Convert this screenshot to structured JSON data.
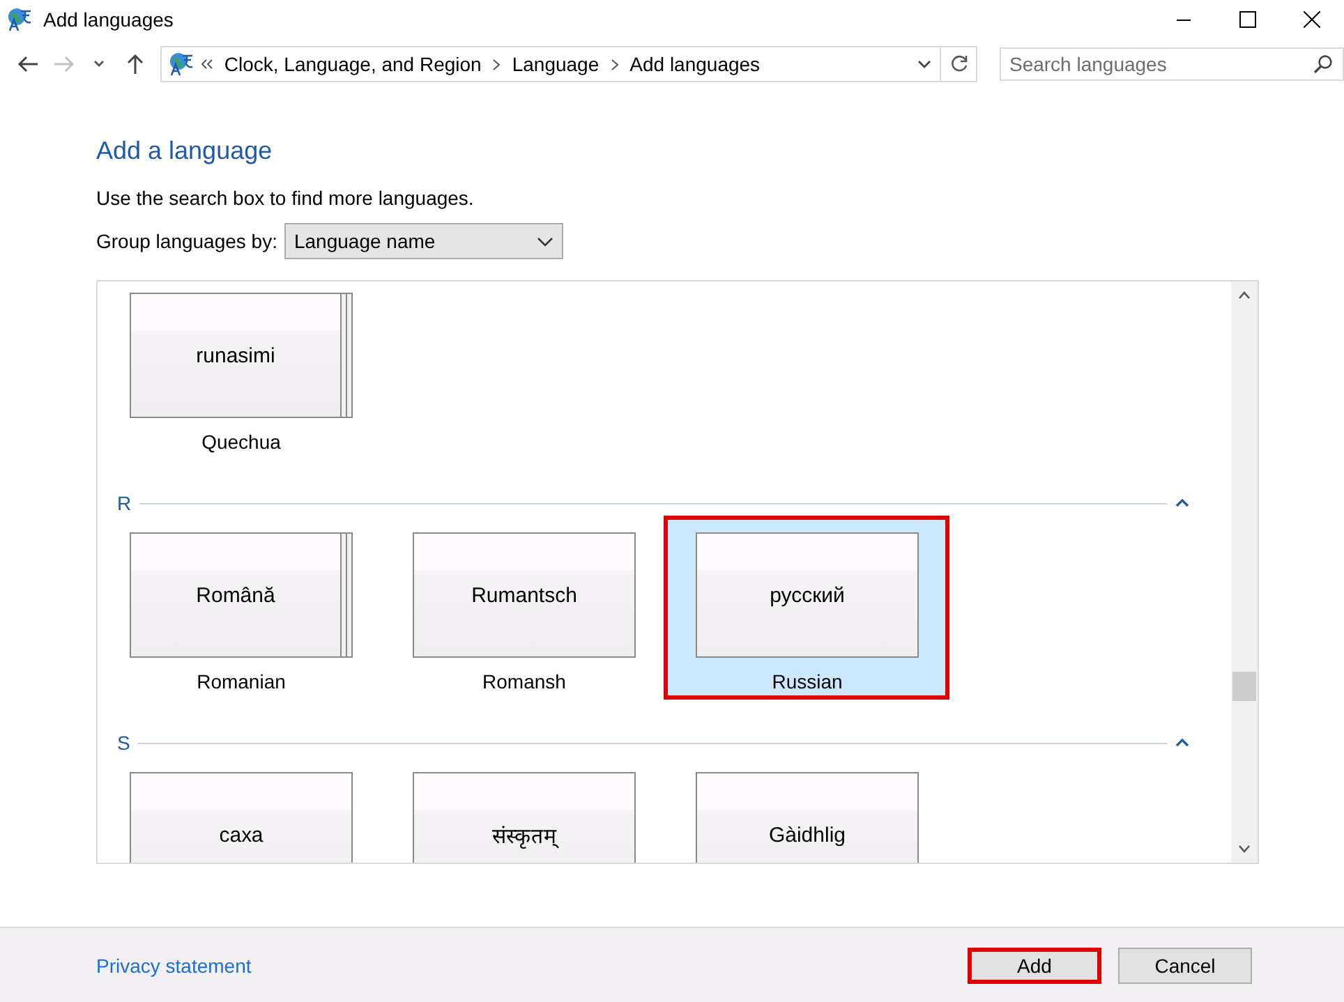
{
  "window": {
    "title": "Add languages"
  },
  "nav": {
    "back_disabled": false,
    "forward_disabled": true
  },
  "address": {
    "crumbs": [
      "Clock, Language, and Region",
      "Language",
      "Add languages"
    ]
  },
  "search": {
    "placeholder": "Search languages"
  },
  "heading": "Add a language",
  "hint": "Use the search box to find more languages.",
  "group_by": {
    "label": "Group languages by:",
    "value": "Language name"
  },
  "groups": [
    {
      "items": [
        {
          "native": "runasimi",
          "name": "Quechua",
          "stacked": true,
          "selected": false,
          "highlighted": false
        }
      ]
    },
    {
      "letter": "R",
      "items": [
        {
          "native": "Română",
          "name": "Romanian",
          "stacked": true,
          "selected": false,
          "highlighted": false
        },
        {
          "native": "Rumantsch",
          "name": "Romansh",
          "stacked": false,
          "selected": false,
          "highlighted": false
        },
        {
          "native": "русский",
          "name": "Russian",
          "stacked": false,
          "selected": true,
          "highlighted": true
        }
      ]
    },
    {
      "letter": "S",
      "items": [
        {
          "native": "саха",
          "stacked": false,
          "selected": false,
          "highlighted": false
        },
        {
          "native": "संस्कृतम्",
          "stacked": false,
          "selected": false,
          "highlighted": false
        },
        {
          "native": "Gàidhlig",
          "stacked": false,
          "selected": false,
          "highlighted": false
        }
      ]
    }
  ],
  "footer": {
    "link": "Privacy statement",
    "buttons": [
      {
        "label": "Add",
        "highlighted": true
      },
      {
        "label": "Cancel",
        "highlighted": false
      }
    ]
  }
}
